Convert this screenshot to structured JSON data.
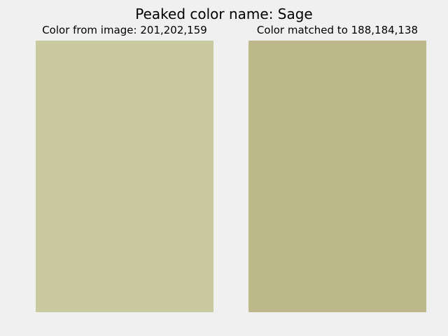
{
  "title": "Peaked color name: Sage",
  "panels": [
    {
      "title": "Color from image: 201,202,159",
      "color": "#c9ca9f"
    },
    {
      "title": "Color matched to 188,184,138",
      "color": "#bcb88a"
    }
  ],
  "colors": {
    "background": "#f0f0f0",
    "text": "#000000"
  }
}
